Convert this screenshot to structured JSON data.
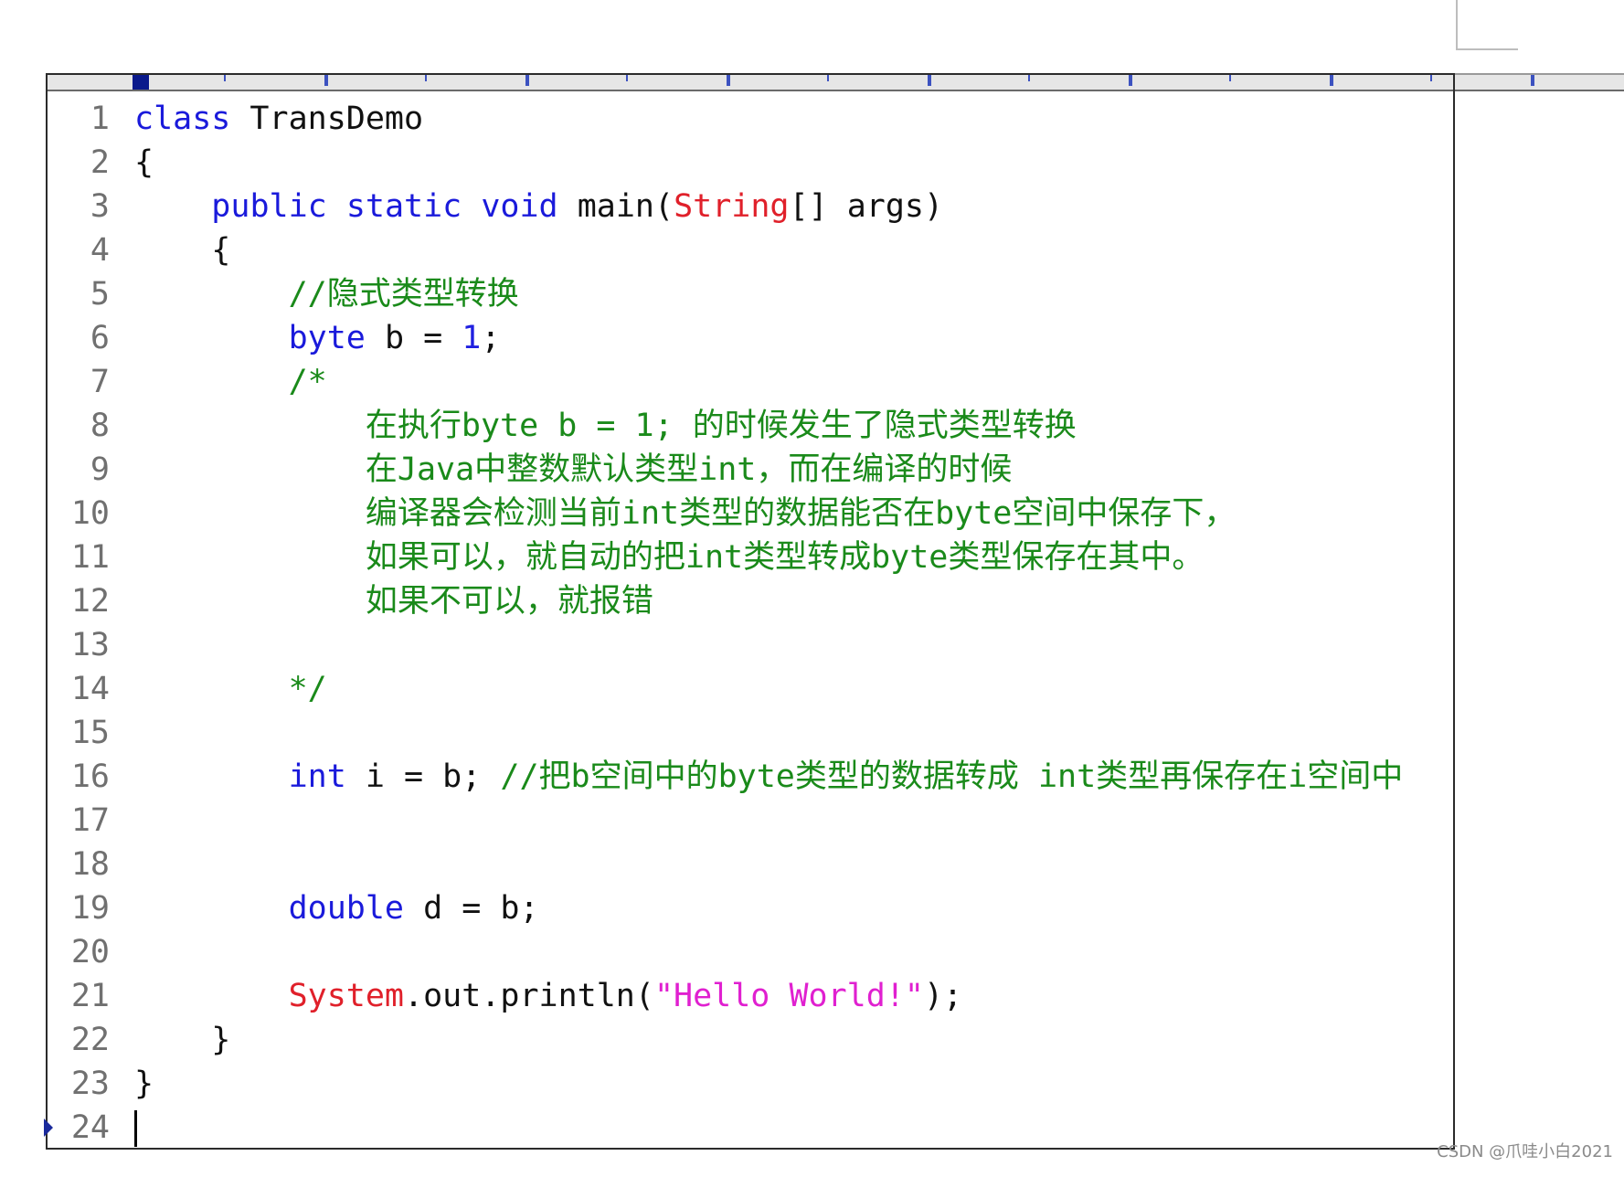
{
  "editor": {
    "lines": [
      {
        "n": "1",
        "parts": [
          {
            "t": "class",
            "c": "kw"
          },
          {
            "t": " TransDemo",
            "c": ""
          }
        ]
      },
      {
        "n": "2",
        "parts": [
          {
            "t": "{",
            "c": ""
          }
        ]
      },
      {
        "n": "3",
        "parts": [
          {
            "t": "    ",
            "c": ""
          },
          {
            "t": "public",
            "c": "kw"
          },
          {
            "t": " ",
            "c": ""
          },
          {
            "t": "static",
            "c": "kw"
          },
          {
            "t": " ",
            "c": ""
          },
          {
            "t": "void",
            "c": "kw"
          },
          {
            "t": " main(",
            "c": ""
          },
          {
            "t": "String",
            "c": "cls"
          },
          {
            "t": "[] args)",
            "c": ""
          }
        ]
      },
      {
        "n": "4",
        "parts": [
          {
            "t": "    {",
            "c": ""
          }
        ]
      },
      {
        "n": "5",
        "parts": [
          {
            "t": "        ",
            "c": ""
          },
          {
            "t": "//隐式类型转换",
            "c": "cm"
          }
        ]
      },
      {
        "n": "6",
        "parts": [
          {
            "t": "        ",
            "c": ""
          },
          {
            "t": "byte",
            "c": "kw"
          },
          {
            "t": " b = ",
            "c": ""
          },
          {
            "t": "1",
            "c": "num"
          },
          {
            "t": ";",
            "c": ""
          }
        ]
      },
      {
        "n": "7",
        "parts": [
          {
            "t": "        ",
            "c": ""
          },
          {
            "t": "/*",
            "c": "cm"
          }
        ]
      },
      {
        "n": "8",
        "parts": [
          {
            "t": "            ",
            "c": ""
          },
          {
            "t": "在执行byte b = 1; 的时候发生了隐式类型转换",
            "c": "cm"
          }
        ]
      },
      {
        "n": "9",
        "parts": [
          {
            "t": "            ",
            "c": ""
          },
          {
            "t": "在Java中整数默认类型int，而在编译的时候",
            "c": "cm"
          }
        ]
      },
      {
        "n": "10",
        "parts": [
          {
            "t": "            ",
            "c": ""
          },
          {
            "t": "编译器会检测当前int类型的数据能否在byte空间中保存下，",
            "c": "cm"
          }
        ]
      },
      {
        "n": "11",
        "parts": [
          {
            "t": "            ",
            "c": ""
          },
          {
            "t": "如果可以，就自动的把int类型转成byte类型保存在其中。",
            "c": "cm"
          }
        ]
      },
      {
        "n": "12",
        "parts": [
          {
            "t": "            ",
            "c": ""
          },
          {
            "t": "如果不可以，就报错",
            "c": "cm"
          }
        ]
      },
      {
        "n": "13",
        "parts": []
      },
      {
        "n": "14",
        "parts": [
          {
            "t": "        ",
            "c": ""
          },
          {
            "t": "*/",
            "c": "cm"
          }
        ]
      },
      {
        "n": "15",
        "parts": []
      },
      {
        "n": "16",
        "parts": [
          {
            "t": "        ",
            "c": ""
          },
          {
            "t": "int",
            "c": "kw"
          },
          {
            "t": " i = b; ",
            "c": ""
          },
          {
            "t": "//把b空间中的byte类型的数据转成 int类型再保存在i空间中",
            "c": "cm"
          }
        ]
      },
      {
        "n": "17",
        "parts": []
      },
      {
        "n": "18",
        "parts": []
      },
      {
        "n": "19",
        "parts": [
          {
            "t": "        ",
            "c": ""
          },
          {
            "t": "double",
            "c": "kw"
          },
          {
            "t": " d = b;",
            "c": ""
          }
        ]
      },
      {
        "n": "20",
        "parts": []
      },
      {
        "n": "21",
        "parts": [
          {
            "t": "        ",
            "c": ""
          },
          {
            "t": "System",
            "c": "cls"
          },
          {
            "t": ".out.println(",
            "c": ""
          },
          {
            "t": "\"Hello World!\"",
            "c": "str"
          },
          {
            "t": ");",
            "c": ""
          }
        ]
      },
      {
        "n": "22",
        "parts": [
          {
            "t": "    }",
            "c": ""
          }
        ]
      },
      {
        "n": "23",
        "parts": [
          {
            "t": "}",
            "c": ""
          }
        ]
      },
      {
        "n": "24",
        "parts": [],
        "current": true
      }
    ]
  },
  "colors": {
    "keyword": "#1a1adb",
    "class": "#e0202a",
    "string": "#e020d0",
    "comment": "#1a8a1a",
    "number": "#2020e0"
  },
  "watermark": "CSDN @爪哇小白2021"
}
